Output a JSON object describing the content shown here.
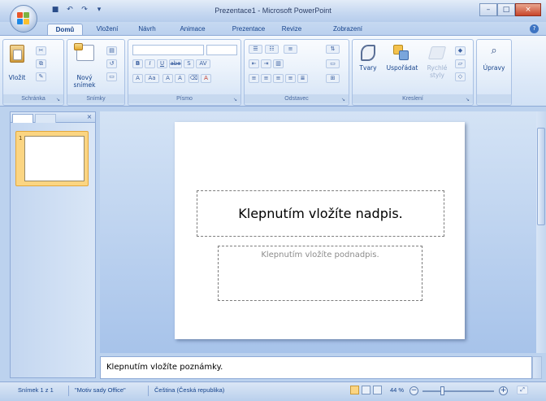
{
  "window": {
    "title": "Prezentace1 - Microsoft PowerPoint",
    "controls": {
      "minimize": "–",
      "maximize": "□",
      "close": "×"
    }
  },
  "quick_access": {
    "save": "■",
    "undo": "↶",
    "redo": "↷",
    "customize": "▾"
  },
  "tabs": [
    {
      "label": "Domů",
      "active": true
    },
    {
      "label": "Vložení"
    },
    {
      "label": "Návrh"
    },
    {
      "label": "Animace"
    },
    {
      "label": "Prezentace"
    },
    {
      "label": "Revize"
    },
    {
      "label": "Zobrazení"
    }
  ],
  "help": "?",
  "ribbon": {
    "groups": {
      "clipboard": {
        "label": "Schránka",
        "paste": "Vložit"
      },
      "slides": {
        "label": "Snímky",
        "new_slide": "Nový snímek"
      },
      "font": {
        "label": "Písmo",
        "bold": "B",
        "italic": "I",
        "underline": "U",
        "strike": "abe",
        "shadow": "S",
        "spacing": "AV",
        "grow": "A",
        "shrink": "A",
        "clear": "Aa",
        "color": "A"
      },
      "paragraph": {
        "label": "Odstavec"
      },
      "drawing": {
        "label": "Kreslení",
        "shapes": "Tvary",
        "arrange": "Uspořádat",
        "quick_styles": "Rychlé styly"
      },
      "editing": {
        "label": "",
        "upravy": "Úpravy"
      }
    }
  },
  "left_pane": {
    "close": "×",
    "slide_number": "1"
  },
  "slide": {
    "title_placeholder": "Klepnutím vložíte nadpis.",
    "subtitle_placeholder": "Klepnutím vložíte podnadpis."
  },
  "notes": {
    "placeholder": "Klepnutím vložíte poznámky."
  },
  "status_bar": {
    "slide_info": "Snímek 1 z 1",
    "theme": "\"Motiv sady Office\"",
    "language": "Čeština (Česká republika)",
    "zoom": "44 %",
    "zoom_out": "−",
    "zoom_in": "+",
    "zoom_level": 0.44
  }
}
